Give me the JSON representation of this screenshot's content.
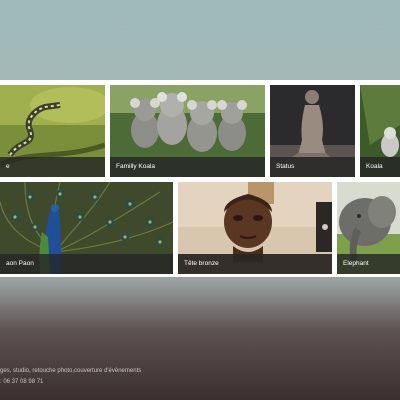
{
  "gallery": {
    "tiles": [
      {
        "caption": "e"
      },
      {
        "caption": "Familly Koala"
      },
      {
        "caption": "Status"
      },
      {
        "caption": "Koala"
      },
      {
        "caption": "aon Paon"
      },
      {
        "caption": "Tête bronze"
      },
      {
        "caption": "Elephant"
      }
    ]
  },
  "footer": {
    "services": "ges, studio, retouche photo,couverture d'évènements",
    "phone": ": 06 37 08 98 71"
  }
}
